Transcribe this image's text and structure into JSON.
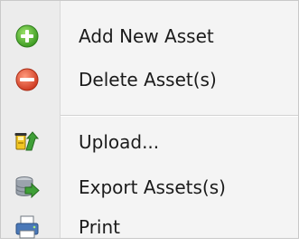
{
  "menu": {
    "items": [
      {
        "label": "Add New Asset",
        "icon": "add-circle-icon"
      },
      {
        "label": "Delete Asset(s)",
        "icon": "delete-circle-icon"
      },
      {
        "label": "Upload...",
        "icon": "upload-icon"
      },
      {
        "label": "Export Assets(s)",
        "icon": "export-database-icon"
      },
      {
        "label": "Print",
        "icon": "printer-icon"
      }
    ]
  },
  "colors": {
    "add_green": "#5cb335",
    "delete_red": "#e0553a",
    "upload_green": "#3fa037",
    "upload_yellow": "#f2c624",
    "database_gray": "#9ba3ad",
    "printer_blue": "#4a78b8"
  }
}
